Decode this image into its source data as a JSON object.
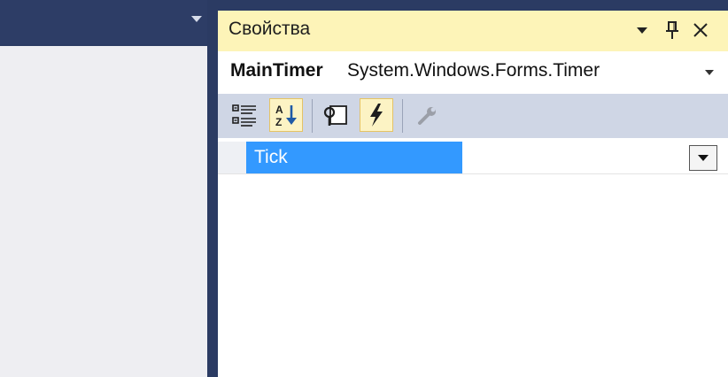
{
  "properties_window": {
    "title": "Свойства",
    "object_name": "MainTimer",
    "object_type": "System.Windows.Forms.Timer",
    "toolbar": {
      "buttons": [
        {
          "name": "categorized-icon",
          "active": false
        },
        {
          "name": "alphabetical-icon",
          "active": true
        },
        {
          "name": "properties-icon",
          "active": false
        },
        {
          "name": "events-lightning-icon",
          "active": true
        },
        {
          "name": "property-pages-wrench-icon",
          "active": false,
          "disabled": true
        }
      ]
    },
    "grid": {
      "rows": [
        {
          "name": "Tick",
          "value": ""
        }
      ]
    }
  },
  "colors": {
    "frame": "#2b3b63",
    "title_bar": "#fdf4b8",
    "toolbar": "#cfd6e5",
    "selection": "#3399ff",
    "active_button": "#fcf3c4"
  }
}
